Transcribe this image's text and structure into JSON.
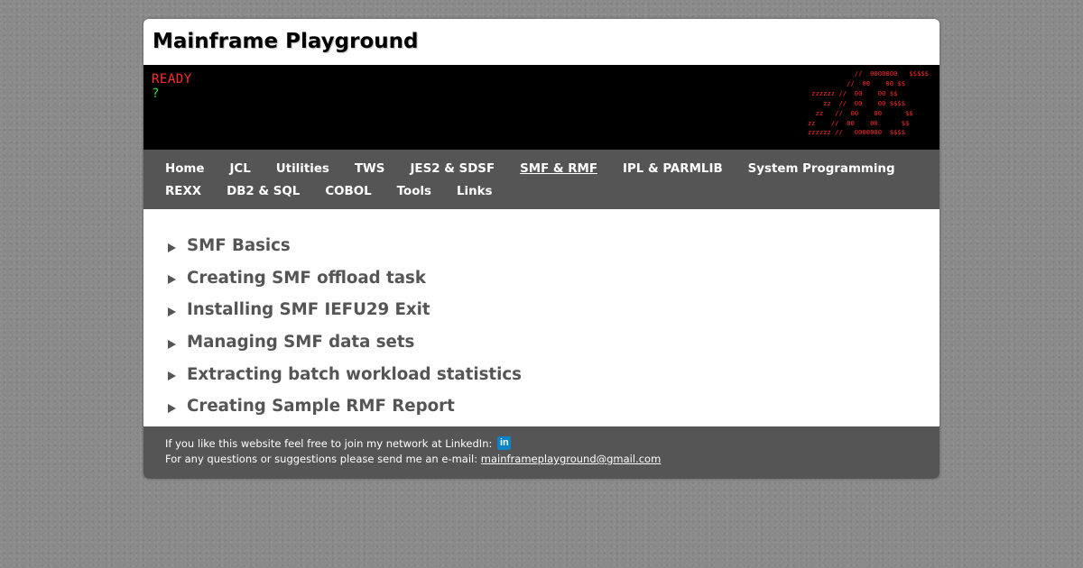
{
  "header": {
    "title": "Mainframe Playground"
  },
  "terminal": {
    "ready": "READY",
    "prompt": "?",
    "ascii_art": "            //  0000000   $$$$$\n          //  00    00 $$\n zzzzzz //  00    00 $$\n    zz  //  00    00 $$$$\n  zz   //  00    00      $$\nzz    //  00    00      $$\nzzzzzz //   0000000  $$$$"
  },
  "nav": {
    "row1": [
      {
        "label": "Home"
      },
      {
        "label": "JCL"
      },
      {
        "label": "Utilities"
      },
      {
        "label": "TWS"
      },
      {
        "label": "JES2 & SDSF"
      },
      {
        "label": "SMF & RMF"
      },
      {
        "label": "IPL & PARMLIB"
      },
      {
        "label": "System Programming"
      }
    ],
    "row2": [
      {
        "label": "REXX"
      },
      {
        "label": "DB2 & SQL"
      },
      {
        "label": "COBOL"
      },
      {
        "label": "Tools"
      },
      {
        "label": "Links"
      }
    ],
    "active": "SMF & RMF"
  },
  "articles": [
    {
      "label": "SMF Basics"
    },
    {
      "label": "Creating SMF offload task"
    },
    {
      "label": "Installing SMF IEFU29 Exit"
    },
    {
      "label": "Managing SMF data sets"
    },
    {
      "label": "Extracting batch workload statistics"
    },
    {
      "label": "Creating Sample RMF Report"
    }
  ],
  "footer": {
    "linkedin_text": "If you like this website feel free to join my network at LinkedIn:",
    "linkedin_icon_text": "in",
    "email_text": "For any questions or suggestions please send me an e-mail:",
    "email": "mainframeplayground@gmail.com"
  },
  "colors": {
    "nav_background": "#555555",
    "terminal_red": "#ff2a2a",
    "terminal_green": "#33dd33",
    "linkedin_blue": "#0a84c6"
  }
}
